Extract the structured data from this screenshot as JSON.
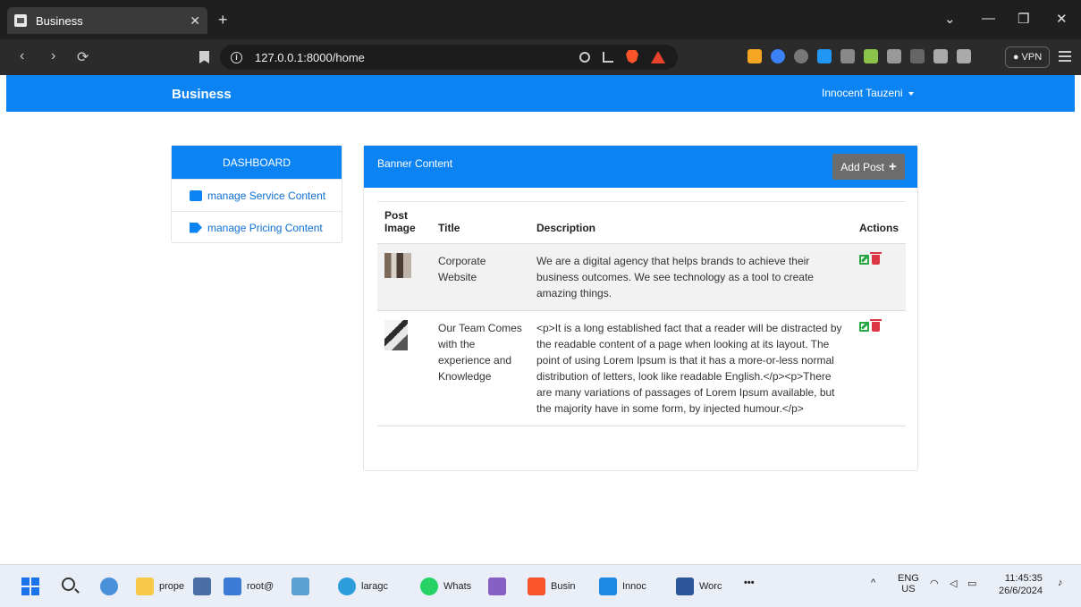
{
  "browser": {
    "tab_title": "Business",
    "tab_close": "✕",
    "new_tab": "+",
    "url": "127.0.0.1:8000/home",
    "vpn_label": "● VPN",
    "window_controls": [
      "⌄",
      "—",
      "❐",
      "✕"
    ]
  },
  "navbar": {
    "brand": "Business",
    "user": "Innocent Tauzeni"
  },
  "sidebar": {
    "heading": "DASHBOARD",
    "items": [
      {
        "label": "manage Service Content",
        "icon": "briefcase-icon"
      },
      {
        "label": "manage Pricing Content",
        "icon": "tag-icon"
      }
    ]
  },
  "panel": {
    "title": "Banner Content",
    "add_button": "Add Post",
    "columns": [
      "Post Image",
      "Title",
      "Description",
      "Actions"
    ],
    "rows": [
      {
        "title": "Corporate Website",
        "description": "We are a digital agency that helps brands to achieve their business outcomes. We see technology as a tool to create amazing things."
      },
      {
        "title": "Our Team Comes with the experience and Knowledge",
        "description": "<p>It is a long established fact that a reader will be distracted by the readable content of a page when looking at its layout. The point of using Lorem Ipsum is that it has a more-or-less normal distribution of letters, look like readable English.</p><p>There are many variations of passages of Lorem Ipsum available, but the majority have in some form, by injected humour.</p>"
      }
    ]
  },
  "taskbar": {
    "items": [
      "prope",
      "root@",
      "laragc",
      "Whats",
      "Busin",
      "Innoc",
      "Worc"
    ],
    "more": "•••",
    "lang_top": "ENG",
    "lang_bottom": "US",
    "time": "11:45:35",
    "date": "26/6/2024"
  },
  "colors": {
    "primary": "#0c83f3",
    "button_gray": "#6c6c6c",
    "edit_green": "#28a745",
    "delete_red": "#dc3545"
  }
}
